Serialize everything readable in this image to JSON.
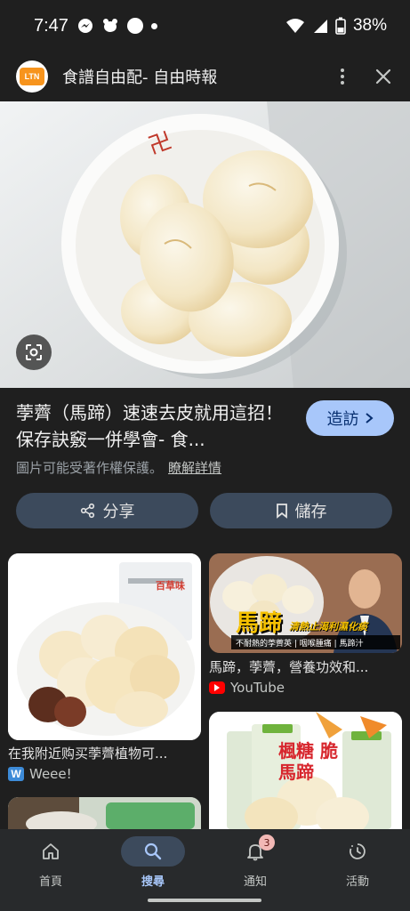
{
  "status_bar": {
    "time": "7:47",
    "battery": "38%"
  },
  "header": {
    "logo_text": "LTN",
    "title": "食譜自由配- 自由時報"
  },
  "result": {
    "title": "荸薺（馬蹄）速速去皮就用這招！保存訣竅一併學會- 食...",
    "visit_label": "造訪",
    "copyright_notice": "圖片可能受著作權保護。",
    "learn_more": "瞭解詳情",
    "share_label": "分享",
    "save_label": "儲存"
  },
  "grid": {
    "items": [
      {
        "caption": "在我附近购买荸薺植物可...",
        "source": "Weee!",
        "source_icon": "weee-icon"
      },
      {
        "caption": "馬蹄，荸薺，營養功效和...",
        "source": "YouTube",
        "source_icon": "youtube-icon",
        "overlay_title": "馬蹄",
        "overlay_subtitle": "清熱止渴利濕化痰",
        "overlay_tags": "不耐熱的荸薺英 | 咽喉腫痛 | 馬蹄汁"
      },
      {
        "caption": "",
        "source": "",
        "product_text": "楓糖 脆馬蹄"
      },
      {
        "caption": "",
        "source": ""
      }
    ],
    "product_brand": "百草味"
  },
  "bottom_nav": {
    "items": [
      {
        "label": "首頁",
        "icon": "home-icon"
      },
      {
        "label": "搜尋",
        "icon": "search-icon",
        "active": true
      },
      {
        "label": "通知",
        "icon": "bell-icon",
        "badge": "3"
      },
      {
        "label": "活動",
        "icon": "activity-icon"
      }
    ]
  }
}
